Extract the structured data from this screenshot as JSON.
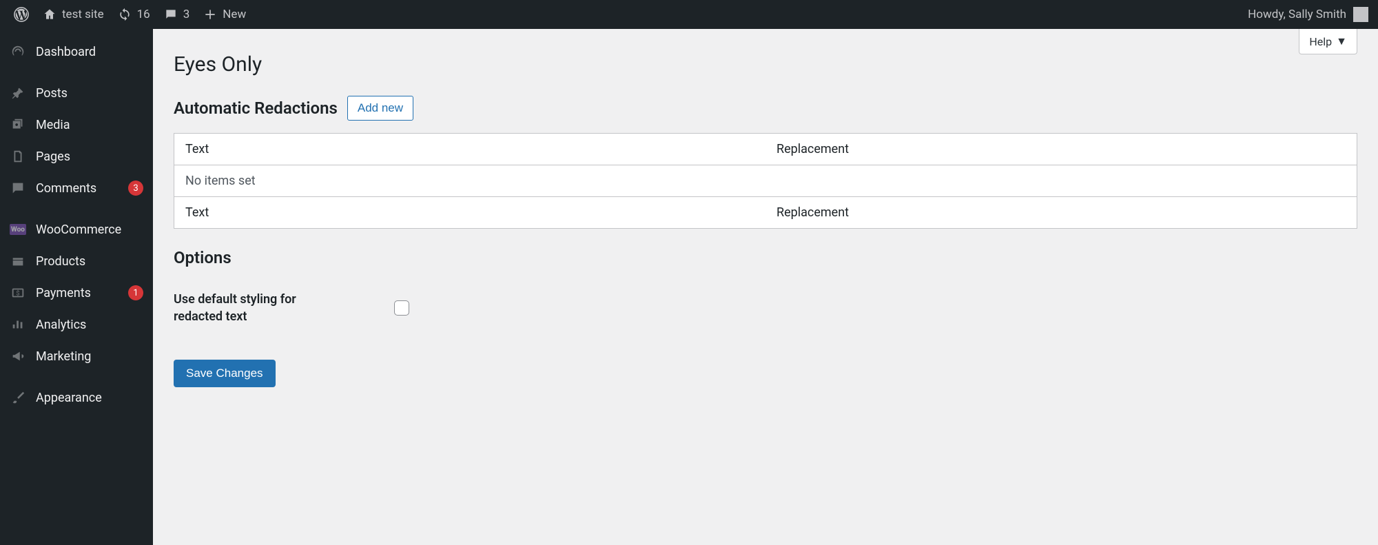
{
  "topbar": {
    "site_name": "test site",
    "updates_count": "16",
    "comments_count": "3",
    "new_label": "New",
    "howdy": "Howdy, Sally Smith"
  },
  "sidebar": {
    "items": [
      {
        "label": "Dashboard",
        "icon": "dashboard"
      },
      {
        "label": "Posts",
        "icon": "pin"
      },
      {
        "label": "Media",
        "icon": "media"
      },
      {
        "label": "Pages",
        "icon": "page"
      },
      {
        "label": "Comments",
        "icon": "comment",
        "badge": "3"
      },
      {
        "label": "WooCommerce",
        "icon": "woo"
      },
      {
        "label": "Products",
        "icon": "products"
      },
      {
        "label": "Payments",
        "icon": "payments",
        "badge": "1"
      },
      {
        "label": "Analytics",
        "icon": "analytics"
      },
      {
        "label": "Marketing",
        "icon": "marketing"
      },
      {
        "label": "Appearance",
        "icon": "appearance"
      }
    ]
  },
  "help_label": "Help",
  "page": {
    "title": "Eyes Only",
    "redactions": {
      "heading": "Automatic Redactions",
      "add_new": "Add new",
      "columns": {
        "text": "Text",
        "replacement": "Replacement"
      },
      "empty_message": "No items set"
    },
    "options": {
      "heading": "Options",
      "option1_label": "Use default styling for redacted text"
    },
    "save_label": "Save Changes"
  }
}
